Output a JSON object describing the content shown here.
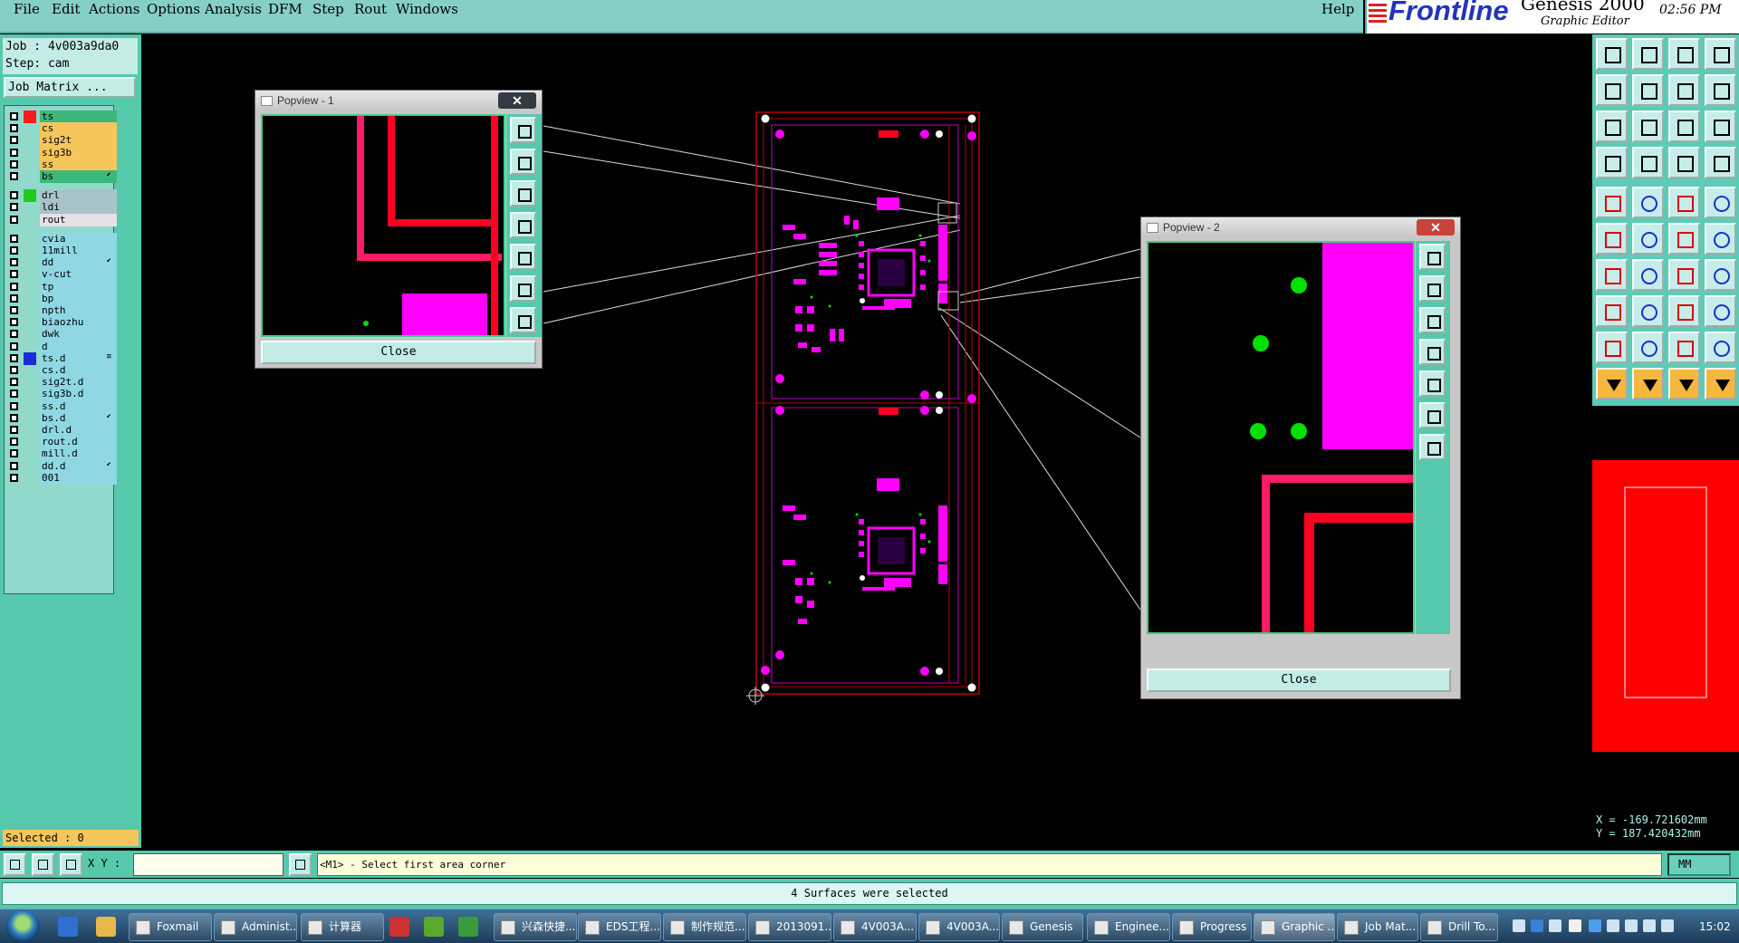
{
  "menu": {
    "file": "File",
    "edit": "Edit",
    "actions": "Actions",
    "options": "Options",
    "analysis": "Analysis",
    "dfm": "DFM",
    "step": "Step",
    "rout": "Rout",
    "windows": "Windows",
    "help": "Help"
  },
  "branding": {
    "logo": "Frontline",
    "product": "Genesis 2000",
    "subtitle": "Graphic Editor",
    "time": "02:56 PM"
  },
  "job": {
    "job_line": "Job : 4v003a9da0",
    "step_line": "Step: cam",
    "job_matrix_label": "Job Matrix ..."
  },
  "layers": [
    {
      "name": "ts",
      "color": "#ff1a1a",
      "bg": "#3cb97a",
      "mark": ""
    },
    {
      "name": "cs",
      "color": "",
      "bg": "#f5c65c",
      "mark": ""
    },
    {
      "name": "sig2t",
      "color": "",
      "bg": "#f5c65c",
      "mark": ""
    },
    {
      "name": "sig3b",
      "color": "",
      "bg": "#f5c65c",
      "mark": ""
    },
    {
      "name": "ss",
      "color": "",
      "bg": "#f5c65c",
      "mark": ""
    },
    {
      "name": "bs",
      "color": "",
      "bg": "#3cb97a",
      "mark": "⬋"
    },
    {
      "name": "drl",
      "color": "#1fcc1f",
      "bg": "#a8c4c9",
      "mark": ""
    },
    {
      "name": "ldi",
      "color": "",
      "bg": "#a8c4c9",
      "mark": ""
    },
    {
      "name": "rout",
      "color": "",
      "bg": "#e8e0e8",
      "mark": ""
    },
    {
      "name": "cvia",
      "color": "",
      "bg": "#8fd8e3",
      "mark": ""
    },
    {
      "name": "11mill",
      "color": "",
      "bg": "#8fd8e3",
      "mark": ""
    },
    {
      "name": "dd",
      "color": "",
      "bg": "#8fd8e3",
      "mark": "⬋"
    },
    {
      "name": "v-cut",
      "color": "",
      "bg": "#8fd8e3",
      "mark": ""
    },
    {
      "name": "tp",
      "color": "",
      "bg": "#8fd8e3",
      "mark": ""
    },
    {
      "name": "bp",
      "color": "",
      "bg": "#8fd8e3",
      "mark": ""
    },
    {
      "name": "npth",
      "color": "",
      "bg": "#8fd8e3",
      "mark": ""
    },
    {
      "name": "biaozhu",
      "color": "",
      "bg": "#8fd8e3",
      "mark": ""
    },
    {
      "name": "dwk",
      "color": "",
      "bg": "#8fd8e3",
      "mark": ""
    },
    {
      "name": "d",
      "color": "",
      "bg": "#8fd8e3",
      "mark": ""
    },
    {
      "name": "ts.d",
      "color": "#1e2bd8",
      "bg": "#8fd8e3",
      "mark": "≡"
    },
    {
      "name": "cs.d",
      "color": "",
      "bg": "#8fd8e3",
      "mark": ""
    },
    {
      "name": "sig2t.d",
      "color": "",
      "bg": "#8fd8e3",
      "mark": ""
    },
    {
      "name": "sig3b.d",
      "color": "",
      "bg": "#8fd8e3",
      "mark": ""
    },
    {
      "name": "ss.d",
      "color": "",
      "bg": "#8fd8e3",
      "mark": ""
    },
    {
      "name": "bs.d",
      "color": "",
      "bg": "#8fd8e3",
      "mark": "⬋"
    },
    {
      "name": "drl.d",
      "color": "",
      "bg": "#8fd8e3",
      "mark": ""
    },
    {
      "name": "rout.d",
      "color": "",
      "bg": "#8fd8e3",
      "mark": ""
    },
    {
      "name": "mill.d",
      "color": "",
      "bg": "#8fd8e3",
      "mark": ""
    },
    {
      "name": "dd.d",
      "color": "",
      "bg": "#8fd8e3",
      "mark": "⬋"
    },
    {
      "name": "001",
      "color": "",
      "bg": "#8fd8e3",
      "mark": ""
    }
  ],
  "selected_label": "Selected : 0",
  "popview1": {
    "title": "Popview - 1",
    "close_x": "✕",
    "close_label": "Close"
  },
  "popview2": {
    "title": "Popview - 2",
    "close_x": "✕",
    "close_label": "Close"
  },
  "coords": {
    "x": "X = -169.721602mm",
    "y": "Y = 187.420432mm"
  },
  "command": {
    "xy_label": "X Y :",
    "input_value": "",
    "prompt": "<M1> - Select first area corner",
    "units": "MM"
  },
  "status": "4 Surfaces were selected",
  "taskbar": {
    "items": [
      {
        "label": "Foxmail"
      },
      {
        "label": "Administ..."
      },
      {
        "label": "计算器"
      },
      {
        "label": "兴森快捷..."
      },
      {
        "label": "EDS工程..."
      },
      {
        "label": "制作规范..."
      },
      {
        "label": "2013091..."
      },
      {
        "label": "4V003A..."
      },
      {
        "label": "4V003A..."
      },
      {
        "label": "Genesis"
      },
      {
        "label": "Enginee..."
      },
      {
        "label": "Progress"
      },
      {
        "label": "Graphic ..."
      },
      {
        "label": "Job Mat..."
      },
      {
        "label": "Drill To..."
      }
    ],
    "clock": "15:02"
  },
  "colors": {
    "pad": "#ff00ff",
    "trace": "#ff0033",
    "drill": "#00e000",
    "frame": "#c11",
    "panel": "#56c9ad"
  }
}
